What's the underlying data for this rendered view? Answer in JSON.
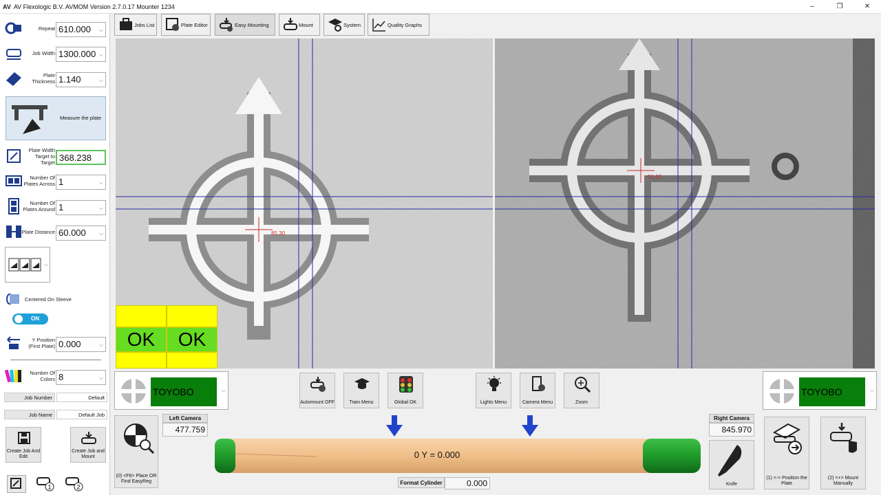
{
  "titlebar": {
    "logo": "AV",
    "title": "AV Flexologic B.V.   AVMOM  Version 2.7.0.17   Mounter 1234",
    "minimize": "–",
    "maximize": "❐",
    "close": "✕"
  },
  "left": {
    "repeat": {
      "label": "Repeat",
      "value": "610.000"
    },
    "job_width": {
      "label": "Job Width",
      "value": "1300.000"
    },
    "plate_thickness": {
      "label": "Plate Thickness",
      "value": "1.140"
    },
    "measure_label": "Measure the plate",
    "plate_width": {
      "label": "Plate Width Target to Target",
      "value": "368.238"
    },
    "plates_across": {
      "label": "Number Of Plates Across",
      "value": "1"
    },
    "plates_around": {
      "label": "Number Of Plates Around",
      "value": "1"
    },
    "plate_distance": {
      "label": "Plate Distance",
      "value": "60.000"
    },
    "centered_label": "Centered On Sleeve",
    "toggle_label": "ON",
    "y_position": {
      "label": "Y Position (First Plate)",
      "value": "0.000"
    },
    "colors": {
      "label": "Number Of Colors",
      "value": "8"
    },
    "job_number": {
      "label": "Job Number",
      "value": "Default"
    },
    "job_name": {
      "label": "Job Name",
      "value": "Default Job"
    },
    "create_edit": "Create Job And Edit",
    "create_mount": "Create Job and Mount"
  },
  "toolbar": {
    "jobs_list": "Jobs List",
    "plate_editor": "Plate Editor",
    "easy_mounting": "Easy Mounting",
    "mount": "Mount",
    "system": "System",
    "quality_graphs": "Quality Graphs"
  },
  "cameras": {
    "left_reading": "85.30",
    "right_reading": "91.62",
    "ok_left": "OK",
    "ok_right": "OK"
  },
  "controls": {
    "left_material": "TOYOBO",
    "right_material": "TOYOBO",
    "automount": "Automount OFF",
    "train_menu": "Train Menu",
    "global_ok": "Global OK",
    "lights_menu": "Lights Menu",
    "camera_menu": "Camera Menu",
    "zoom": "Zoom"
  },
  "bottom": {
    "find_label": "(0) <F6> Place OR Find EasyReg",
    "left_camera_label": "Left Camera",
    "left_camera_value": "477.759",
    "right_camera_label": "Right Camera",
    "right_camera_value": "845.970",
    "cylinder_text": "0 Y = 0.000",
    "format_cylinder_label": "Format Cylinder",
    "format_cylinder_value": "0.000",
    "knife": "Knife",
    "position_plate": "(1) <-> Position the Plate",
    "mount_manually": "(2) <+> Mount Manually"
  },
  "colors": {
    "accent": "#20a0d8",
    "ok_yellow": "#ffff00",
    "ok_green": "#66dd22",
    "material_green": "#0a7e0a",
    "crosshair_blue": "#2a2aa8",
    "cylinder_wood": "#f1bf8a",
    "cylinder_cap": "#1f9a2a"
  }
}
